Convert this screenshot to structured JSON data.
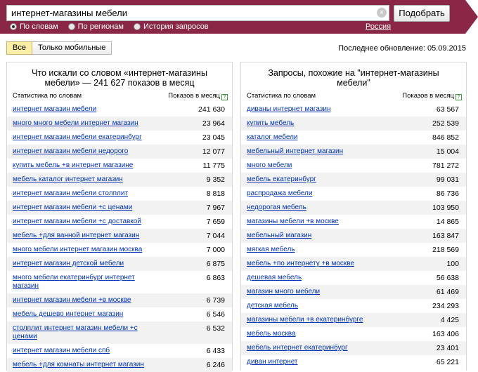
{
  "header": {
    "search_value": "интернет-магазины мебели",
    "submit_label": "Подобрать",
    "radios": [
      {
        "label": "По словам",
        "checked": true
      },
      {
        "label": "По регионам",
        "checked": false
      },
      {
        "label": "История запросов",
        "checked": false
      }
    ],
    "region": "Россия",
    "bg_color": "#8a2747"
  },
  "filters": {
    "all_label": "Все",
    "mobile_label": "Только мобильные"
  },
  "updated_text": "Последнее обновление: 05.09.2015",
  "left_panel": {
    "title": "Что искали со словом «интернет-магазины мебели» — 241 627 показов в месяц",
    "col_words": "Статистика по словам",
    "col_shows": "Показов в месяц",
    "rows": [
      {
        "kw": "интернет магазин мебели",
        "count": "241 630"
      },
      {
        "kw": "много много мебели интернет магазин",
        "count": "23 964"
      },
      {
        "kw": "интернет магазин мебели екатеринбург",
        "count": "23 045"
      },
      {
        "kw": "интернет магазин мебели недорого",
        "count": "12 077"
      },
      {
        "kw": "купить мебель +в интернет магазине",
        "count": "11 775"
      },
      {
        "kw": "мебель каталог интернет магазин",
        "count": "9 352"
      },
      {
        "kw": "интернет магазин мебели столплит",
        "count": "8 818"
      },
      {
        "kw": "интернет магазин мебели +с ценами",
        "count": "7 967"
      },
      {
        "kw": "интернет магазин мебели +с доставкой",
        "count": "7 659"
      },
      {
        "kw": "мебель +для ванной интернет магазин",
        "count": "7 044"
      },
      {
        "kw": "много мебели интернет магазин москва",
        "count": "7 000"
      },
      {
        "kw": "интернет магазин детской мебели",
        "count": "6 875"
      },
      {
        "kw": "много мебели екатеринбург интернет магазин",
        "count": "6 863"
      },
      {
        "kw": "интернет магазин мебели +в москве",
        "count": "6 739"
      },
      {
        "kw": "мебель дешево интернет магазин",
        "count": "6 546"
      },
      {
        "kw": "столплит интернет магазин мебели +с ценами",
        "count": "6 532"
      },
      {
        "kw": "интернет магазин мебели спб",
        "count": "6 433"
      },
      {
        "kw": "мебель +для комнаты интернет магазин",
        "count": "6 246"
      }
    ]
  },
  "right_panel": {
    "title": "Запросы, похожие на \"интернет-магазины мебели\"",
    "col_words": "Статистика по словам",
    "col_shows": "Показов в месяц",
    "rows": [
      {
        "kw": "диваны интернет магазин",
        "count": "63 567"
      },
      {
        "kw": "купить мебель",
        "count": "252 539"
      },
      {
        "kw": "каталог мебели",
        "count": "846 852"
      },
      {
        "kw": "мебельный интернет магазин",
        "count": "15 004"
      },
      {
        "kw": "много мебели",
        "count": "781 272"
      },
      {
        "kw": "мебель екатеринбург",
        "count": "99 031"
      },
      {
        "kw": "распродажа мебели",
        "count": "86 736"
      },
      {
        "kw": "недорогая мебель",
        "count": "103 950"
      },
      {
        "kw": "магазины мебели +в москве",
        "count": "14 865"
      },
      {
        "kw": "мебельный магазин",
        "count": "163 847"
      },
      {
        "kw": "мягкая мебель",
        "count": "218 569"
      },
      {
        "kw": "мебель +по интернету +в москве",
        "count": "100"
      },
      {
        "kw": "дешевая мебель",
        "count": "56 638"
      },
      {
        "kw": "магазин много мебели",
        "count": "61 469"
      },
      {
        "kw": "детская мебель",
        "count": "234 293"
      },
      {
        "kw": "магазины мебели +в екатеринбурге",
        "count": "4 425"
      },
      {
        "kw": "мебель москва",
        "count": "163 406"
      },
      {
        "kw": "мебель интернет екатеринбург",
        "count": "23 401"
      },
      {
        "kw": "диван интернет",
        "count": "65 221"
      }
    ]
  }
}
